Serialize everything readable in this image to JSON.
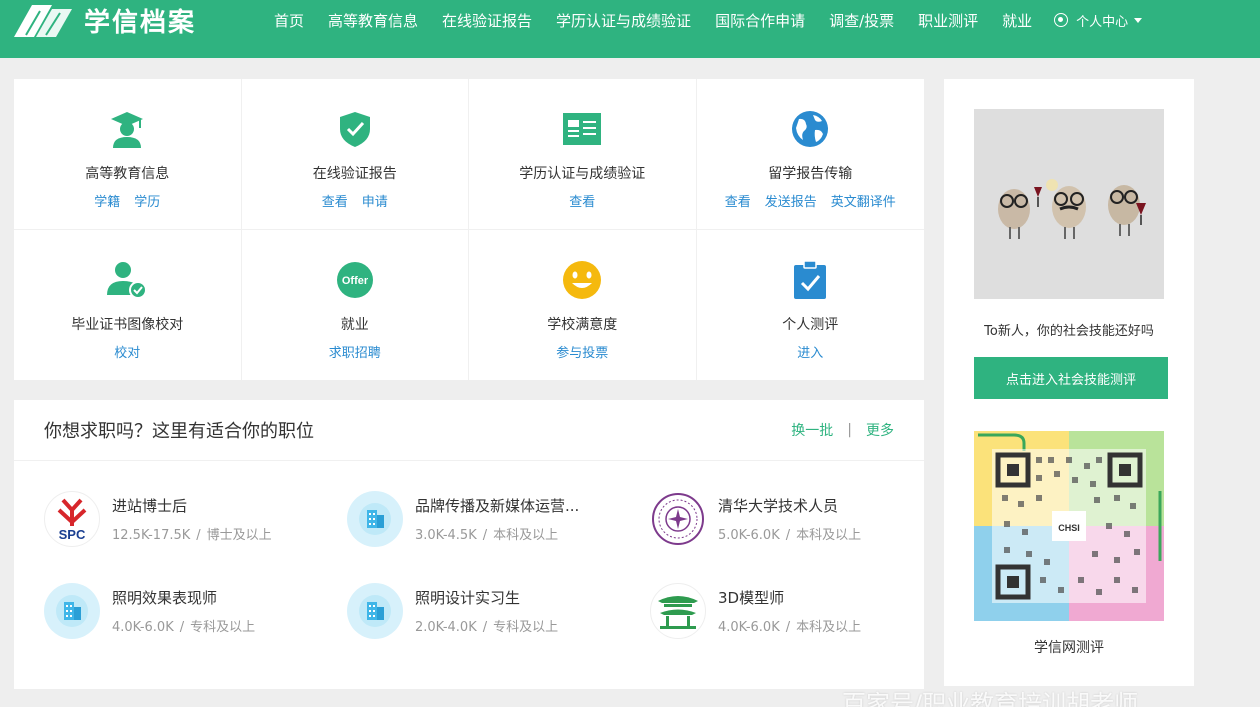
{
  "header": {
    "brand": "学信档案",
    "nav": [
      "首页",
      "高等教育信息",
      "在线验证报告",
      "学历认证与成绩验证",
      "国际合作申请",
      "调查/投票",
      "职业测评",
      "就业"
    ],
    "user_center": "个人中心"
  },
  "services": [
    {
      "title": "高等教育信息",
      "icon": "graduate-icon",
      "links": [
        "学籍",
        "学历"
      ]
    },
    {
      "title": "在线验证报告",
      "icon": "shield-check-icon",
      "links": [
        "查看",
        "申请"
      ]
    },
    {
      "title": "学历认证与成绩验证",
      "icon": "id-card-icon",
      "links": [
        "查看"
      ]
    },
    {
      "title": "留学报告传输",
      "icon": "globe-icon",
      "links": [
        "查看",
        "发送报告",
        "英文翻译件"
      ]
    },
    {
      "title": "毕业证书图像校对",
      "icon": "user-check-icon",
      "links": [
        "校对"
      ]
    },
    {
      "title": "就业",
      "icon": "offer-icon",
      "links": [
        "求职招聘"
      ],
      "badge_text": "Offer"
    },
    {
      "title": "学校满意度",
      "icon": "smile-icon",
      "links": [
        "参与投票"
      ]
    },
    {
      "title": "个人测评",
      "icon": "clipboard-check-icon",
      "links": [
        "进入"
      ]
    }
  ],
  "jobs": {
    "title": "你想求职吗？这里有适合你的职位",
    "refresh": "换一批",
    "more": "更多",
    "items": [
      {
        "name": "进站博士后",
        "salary": "12.5K-17.5K",
        "education": "博士及以上",
        "logo": "spc-logo",
        "logo_text": "SPC"
      },
      {
        "name": "品牌传播及新媒体运营...",
        "salary": "3.0K-4.5K",
        "education": "本科及以上",
        "logo": "building-icon"
      },
      {
        "name": "清华大学技术人员",
        "salary": "5.0K-6.0K",
        "education": "本科及以上",
        "logo": "tsinghua-seal"
      },
      {
        "name": "照明效果表现师",
        "salary": "4.0K-6.0K",
        "education": "专科及以上",
        "logo": "building-icon"
      },
      {
        "name": "照明设计实习生",
        "salary": "2.0K-4.0K",
        "education": "专科及以上",
        "logo": "building-icon"
      },
      {
        "name": "3D模型师",
        "salary": "4.0K-6.0K",
        "education": "本科及以上",
        "logo": "pavilion-logo"
      }
    ]
  },
  "side": {
    "promo": "To新人，你的社会技能还好吗",
    "button": "点击进入社会技能测评",
    "qr_caption": "学信网测评",
    "qr_label": "CHSI"
  },
  "watermark": "百家号/职业教育培训胡老师",
  "colors": {
    "brand": "#2fb380",
    "link": "#2a8bd0",
    "muted": "#999999"
  }
}
